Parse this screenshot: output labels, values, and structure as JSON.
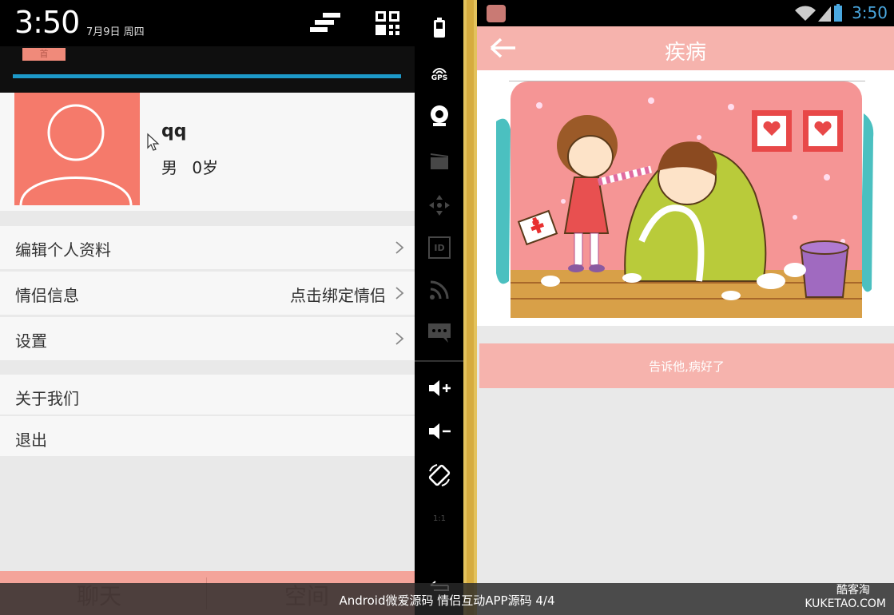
{
  "left_phone": {
    "status_time": "3:50",
    "status_date": "7月9日 周四",
    "tab_fragment": "首",
    "profile": {
      "nickname": "qq",
      "gender": "男",
      "age": "0岁"
    },
    "menu": [
      {
        "label": "编辑个人资料",
        "value": ""
      },
      {
        "label": "情侣信息",
        "value": "点击绑定情侣"
      },
      {
        "label": "设置",
        "value": ""
      },
      {
        "label": "关于我们",
        "value": ""
      },
      {
        "label": "退出",
        "value": ""
      }
    ],
    "bottom_tabs": [
      "聊天",
      "空间"
    ]
  },
  "emulator_sidebar": {
    "icons": [
      "battery-icon",
      "gps-icon",
      "camera-icon",
      "video-icon",
      "dpad-icon",
      "id-icon",
      "rss-icon",
      "sms-icon",
      "volume-up-icon",
      "volume-down-icon",
      "rotate-icon",
      "scale-icon",
      "back-icon"
    ],
    "gps_label": "GPS",
    "id_label": "ID",
    "scale_label": "1:1"
  },
  "right_phone": {
    "status_time": "3:50",
    "title": "疾病",
    "action_button": "告诉他,病好了",
    "illustration": "girl-caring-for-sick-boy-illustration"
  },
  "overlay": {
    "caption": "Android微爱源码 情侣互动APP源码   4/4",
    "watermark_brand": "酷客淘",
    "watermark_url": "KUKETAO.COM"
  },
  "colors": {
    "accent_pink": "#f6b3ad",
    "avatar_coral": "#f57a6b",
    "progress_blue": "#1d99c9",
    "status_blue": "#4aa8e0"
  }
}
